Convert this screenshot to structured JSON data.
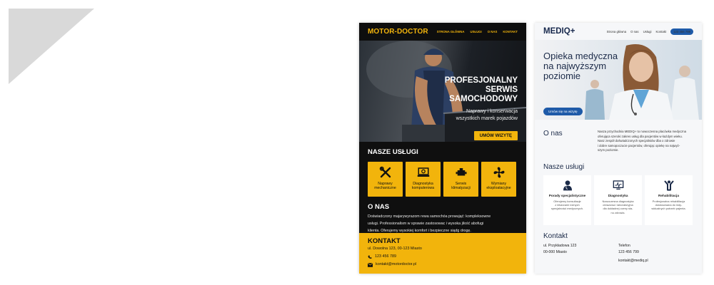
{
  "motor": {
    "logo": "MOTOR-DOCTOR",
    "nav": [
      "STRONA GŁÓWNA",
      "USŁUGI",
      "O NAS",
      "KONTAKT"
    ],
    "hero_title": [
      "PROFESJONALNY",
      "SERWIS",
      "SAMOCHODOWY"
    ],
    "hero_sub": [
      "Naprawy i konserwacja",
      "wszystkich marek pojazdów"
    ],
    "cta": "UMÓW WIZYTĘ",
    "services_title": "NASZE USŁUGI",
    "services": [
      {
        "label": [
          "Naprawy",
          "mechaniczne"
        ],
        "icon": "tools-icon"
      },
      {
        "label": [
          "Diagnostyka",
          "komputerowa"
        ],
        "icon": "laptop-diagnostics-icon"
      },
      {
        "label": [
          "Serwis",
          "klimatyzacji"
        ],
        "icon": "engine-icon"
      },
      {
        "label": [
          "Wymiany",
          "eksploatacyjne"
        ],
        "icon": "fan-icon"
      }
    ],
    "about_title": "O NAS",
    "about_lines": [
      "Doświadczony majarywyrazom rewa samochóa prowująć: kompleksowne",
      "usługi. Professionalism w sprawie zastosowac i wysoka jilość abofugi",
      "klienta. Oferujemy wysokiej komfort i bezpieczne siądg drogę."
    ],
    "contact_title": "KONTAKT",
    "address": "ul. Dowolna 123, 00-123 Miasto",
    "phone": "123 456 789",
    "email": "kontakt@motordoctor.pl",
    "accent": "#f2b40c"
  },
  "mediq": {
    "logo": "MEDIQ+",
    "nav": [
      "Strona główna",
      "O nas",
      "Usługi",
      "Kontakt"
    ],
    "phone_button": "123 456 798",
    "hero_title": [
      "Opieka medyczna",
      "na najwyższym",
      "poziomie"
    ],
    "cta": "Umów się na wizytę",
    "about_title": "O nas",
    "about_lines": [
      "Nasza przychodnia MEDIQ+ to nowoczesna placówka medyczna",
      "oferująca szeroki zakres usług dla pacjentów w każdym wieku.",
      "Nasz zespół doświadczonych specjalistów dba o zdrowie",
      "i dobre samopoczucie pacjentów, oferując opiekę na najwyż-",
      "szym poziomie."
    ],
    "services_title": "Nasze usługi",
    "services": [
      {
        "title": "Porady specjalistyczne",
        "desc": [
          "Oferujemy konsultacje",
          "z lekarzami różnych",
          "specjalności medycznych."
        ],
        "icon": "doctor-icon"
      },
      {
        "title": "Diagnostyka",
        "desc": [
          "Nowoczesna diagnostyka",
          "obrazowa i laboratoryjna",
          "dla dokładnej oceny sta-",
          "nu zdrowia."
        ],
        "icon": "monitor-chart-icon"
      },
      {
        "title": "Rehabilitacja",
        "desc": [
          "Profesjonalna rehabilitacja",
          "dostosowana do indy-",
          "widualnych potrzeb pajenta."
        ],
        "icon": "person-arms-up-icon"
      }
    ],
    "contact_title": "Kontakt",
    "address": [
      "ul. Przykładowa 123",
      "00-000 Miasto"
    ],
    "phone_label": "Telefon",
    "phone": "123 456 799",
    "email": "kontakt@mediq.pl",
    "accent": "#1e5aa8"
  }
}
